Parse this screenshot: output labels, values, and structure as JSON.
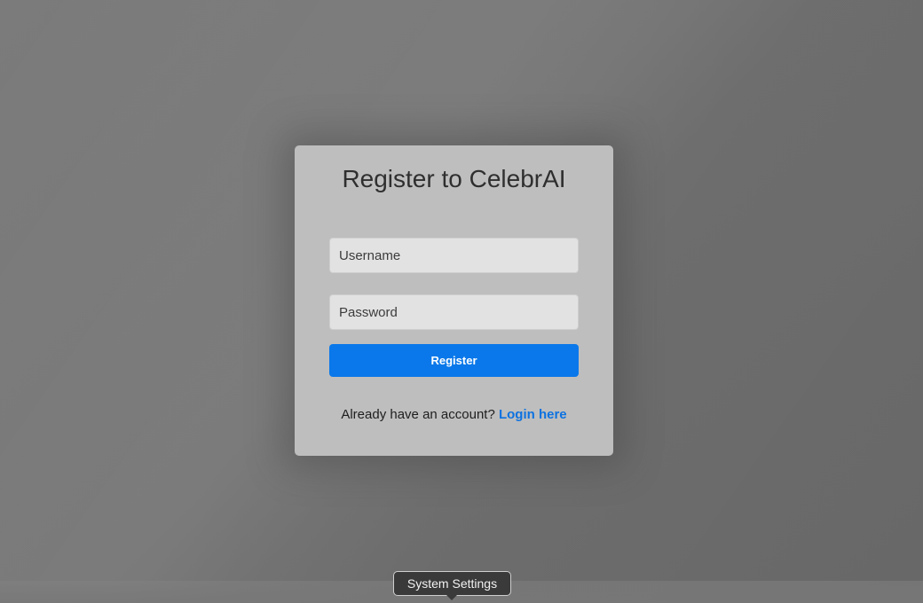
{
  "register_card": {
    "title": "Register to CelebrAI",
    "username": {
      "value": "",
      "placeholder": "Username"
    },
    "password": {
      "value": "",
      "placeholder": "Password"
    },
    "register_button_label": "Register",
    "footer_prompt": "Already have an account?",
    "login_link_label": "Login here"
  },
  "dock_tooltip": {
    "label": "System Settings"
  },
  "colors": {
    "backdrop": "#777777",
    "card": "#bebebe",
    "accent": "#0a78ea",
    "link": "#0d72e0"
  }
}
